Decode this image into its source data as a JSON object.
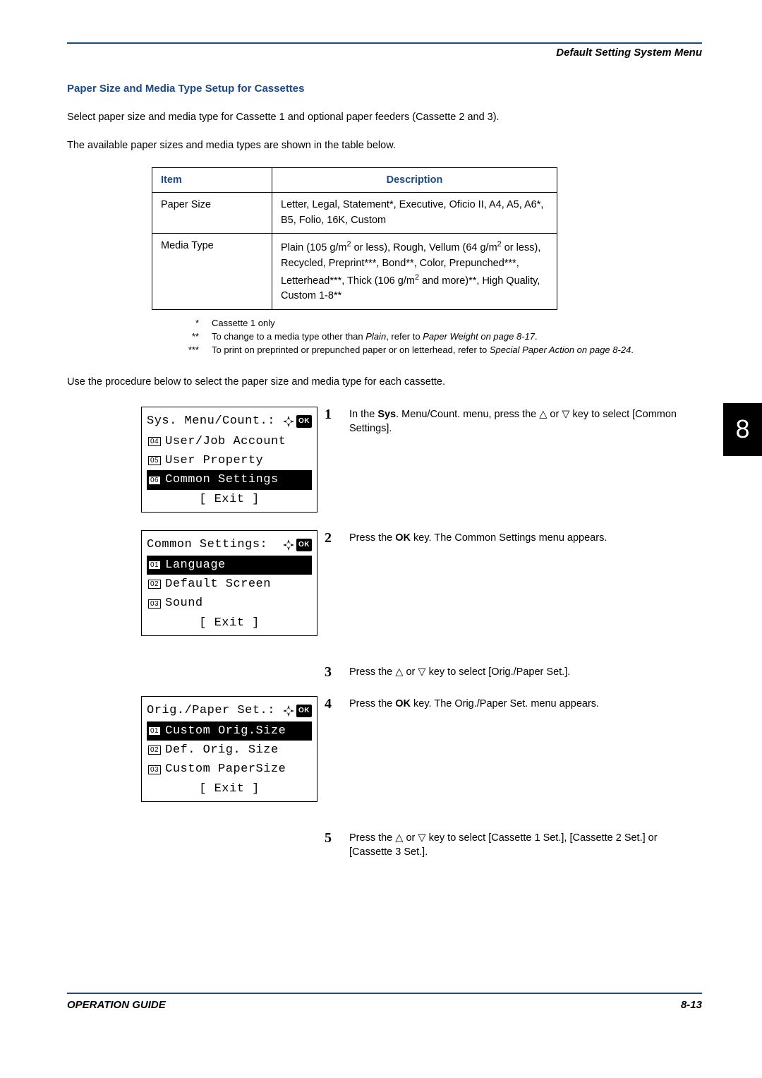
{
  "header": {
    "section_title": "Default Setting System Menu"
  },
  "heading": "Paper Size and Media Type Setup for Cassettes",
  "intro_1": "Select paper size and media type for Cassette 1 and optional paper feeders (Cassette 2 and 3).",
  "intro_2": "The available paper sizes and media types are shown in the table below.",
  "table": {
    "header_item": "Item",
    "header_desc": "Description",
    "rows": [
      {
        "item": "Paper Size",
        "desc": "Letter, Legal, Statement*, Executive, Oficio II, A4, A5, A6*, B5, Folio, 16K, Custom"
      },
      {
        "item": "Media Type",
        "desc_html": "Plain (105 g/m<sup>2</sup> or less), Rough, Vellum (64 g/m<sup>2</sup> or less), Recycled, Preprint***, Bond**, Color, Prepunched***, Letterhead***, Thick (106 g/m<sup>2</sup> and more)**, High Quality, Custom 1-8**"
      }
    ]
  },
  "footnotes": [
    {
      "mark": "*",
      "text": "Cassette 1 only"
    },
    {
      "mark": "**",
      "text": "To change to a media type other than <em>Plain</em>, refer to <em>Paper Weight on page 8-17</em>."
    },
    {
      "mark": "***",
      "text": "To print on preprinted or prepunched paper or on letterhead, refer to <em>Special Paper Action on page 8-24</em>."
    }
  ],
  "procedure_intro": "Use the procedure below to select the paper size and media type for each cassette.",
  "lcd_screens": [
    {
      "title": "Sys. Menu/Count.:",
      "items": [
        {
          "num": "04",
          "label": "User/Job Account",
          "selected": false
        },
        {
          "num": "05",
          "label": "User Property",
          "selected": false
        },
        {
          "num": "06",
          "label": "Common Settings",
          "selected": true
        }
      ],
      "exit": "[  Exit   ]"
    },
    {
      "title": "Common Settings:",
      "items": [
        {
          "num": "01",
          "label": "Language",
          "selected": true
        },
        {
          "num": "02",
          "label": "Default Screen",
          "selected": false
        },
        {
          "num": "03",
          "label": "Sound",
          "selected": false
        }
      ],
      "exit": "[  Exit   ]"
    },
    {
      "title": "Orig./Paper Set.:",
      "items": [
        {
          "num": "01",
          "label": "Custom Orig.Size",
          "selected": true
        },
        {
          "num": "02",
          "label": "Def. Orig. Size",
          "selected": false
        },
        {
          "num": "03",
          "label": "Custom PaperSize",
          "selected": false
        }
      ],
      "exit": "[  Exit   ]"
    }
  ],
  "steps": [
    {
      "num": "1",
      "html": "In the <b>Sys</b>. Menu/Count. menu, press the <span class='tri'>△</span> or <span class='tri'>▽</span> key to select [Common Settings]."
    },
    {
      "num": "2",
      "html": "Press the <b>OK</b> key. The Common Settings menu appears."
    },
    {
      "num": "3",
      "html": "Press the <span class='tri'>△</span> or <span class='tri'>▽</span> key to select [Orig./Paper Set.]."
    },
    {
      "num": "4",
      "html": "Press the <b>OK</b> key. The Orig./Paper Set. menu appears."
    },
    {
      "num": "5",
      "html": "Press the <span class='tri'>△</span> or <span class='tri'>▽</span> key to select [Cassette 1 Set.], [Cassette 2 Set.] or [Cassette 3 Set.]."
    }
  ],
  "chapter_number": "8",
  "footer": {
    "left": "OPERATION GUIDE",
    "right": "8-13"
  }
}
